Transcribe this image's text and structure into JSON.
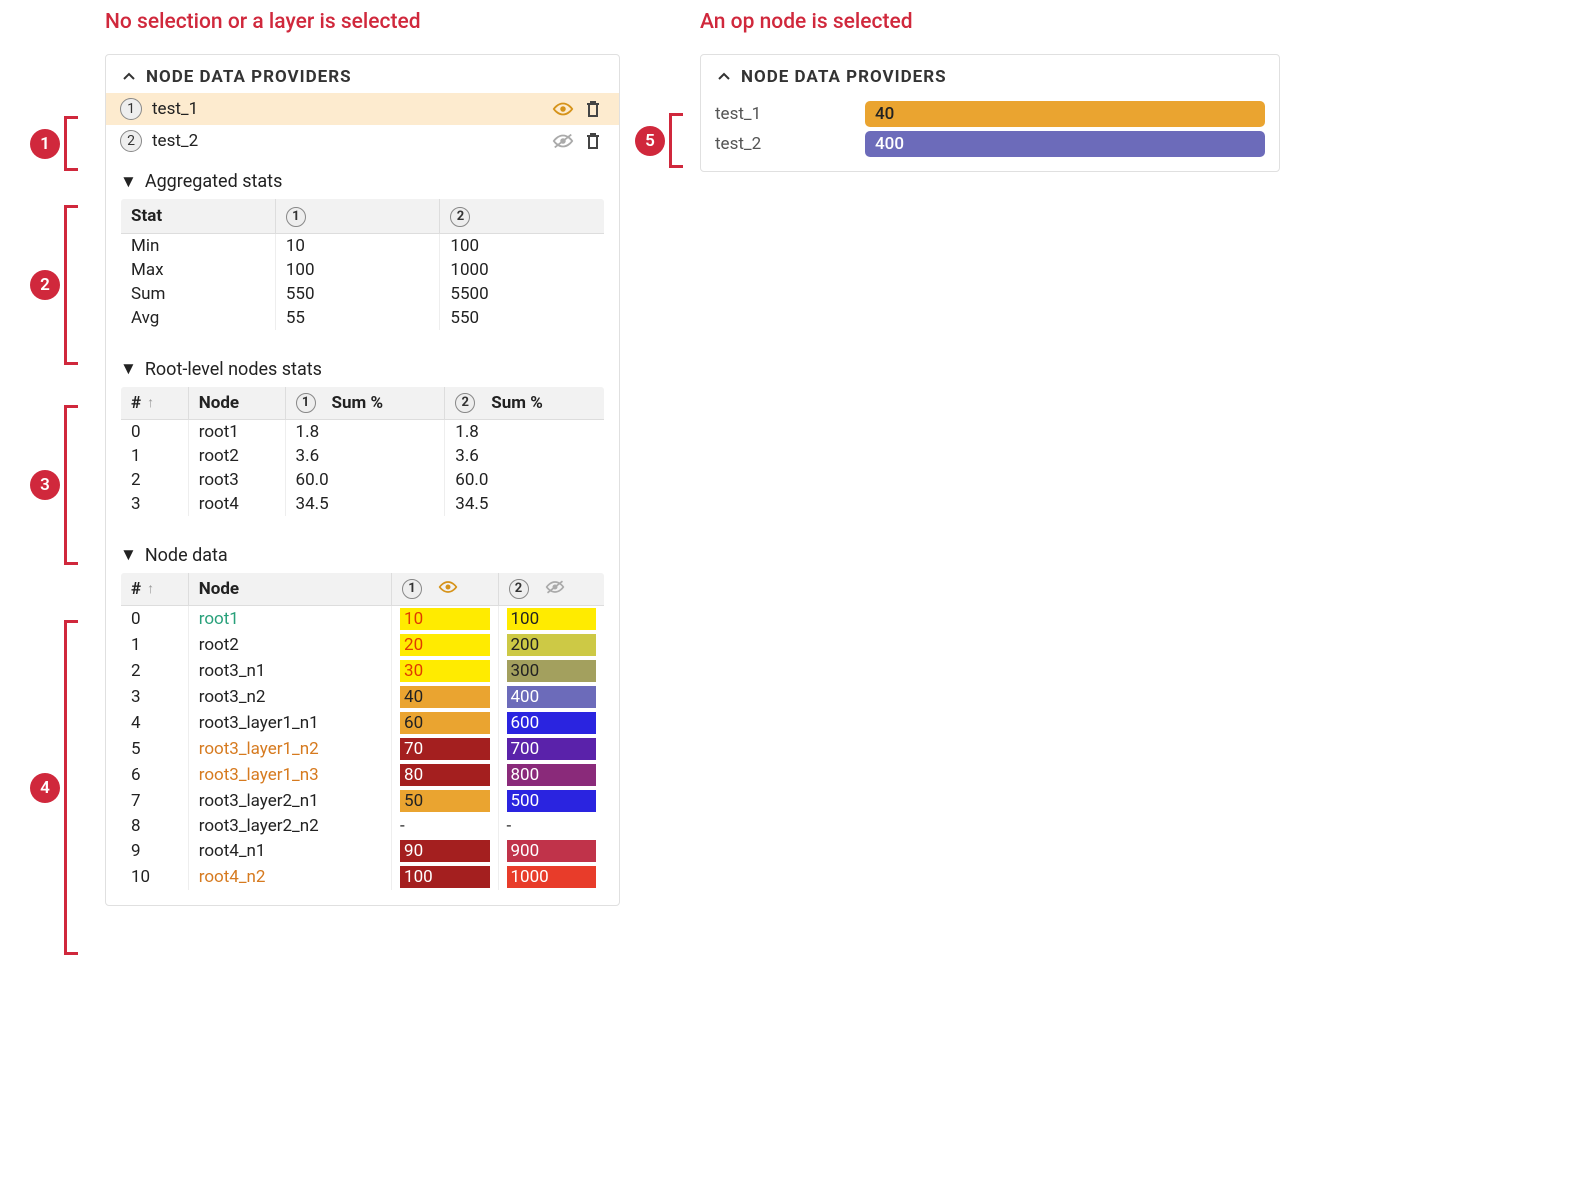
{
  "left": {
    "heading": "No selection or a layer is selected",
    "panel_title": "NODE DATA PROVIDERS",
    "providers": [
      {
        "label": "test_1",
        "badge": "1",
        "active": true,
        "visible": true
      },
      {
        "label": "test_2",
        "badge": "2",
        "active": false,
        "visible": false
      }
    ],
    "aggregated": {
      "title": "Aggregated stats",
      "headers": {
        "stat": "Stat",
        "c1": "1",
        "c2": "2"
      },
      "rows": [
        {
          "stat": "Min",
          "c1": "10",
          "c2": "100"
        },
        {
          "stat": "Max",
          "c1": "100",
          "c2": "1000"
        },
        {
          "stat": "Sum",
          "c1": "550",
          "c2": "5500"
        },
        {
          "stat": "Avg",
          "c1": "55",
          "c2": "550"
        }
      ]
    },
    "root_stats": {
      "title": "Root-level nodes stats",
      "headers": {
        "idx": "#",
        "node": "Node",
        "c1": "Sum %",
        "c2": "Sum %"
      },
      "rows": [
        {
          "idx": "0",
          "node": "root1",
          "c1": "1.8",
          "c2": "1.8"
        },
        {
          "idx": "1",
          "node": "root2",
          "c1": "3.6",
          "c2": "3.6"
        },
        {
          "idx": "2",
          "node": "root3",
          "c1": "60.0",
          "c2": "60.0"
        },
        {
          "idx": "3",
          "node": "root4",
          "c1": "34.5",
          "c2": "34.5"
        }
      ]
    },
    "node_data": {
      "title": "Node data",
      "headers": {
        "idx": "#",
        "node": "Node"
      },
      "rows": [
        {
          "idx": "0",
          "node": "root1",
          "node_style": "link-green",
          "v1": "10",
          "bg1": "#ffeb00",
          "fg1": "#e03c00",
          "v2": "100",
          "bg2": "#ffeb00",
          "fg2": "#222"
        },
        {
          "idx": "1",
          "node": "root2",
          "node_style": "",
          "v1": "20",
          "bg1": "#ffeb00",
          "fg1": "#e03c00",
          "v2": "200",
          "bg2": "#cdc945",
          "fg2": "#222"
        },
        {
          "idx": "2",
          "node": "root3_n1",
          "node_style": "",
          "v1": "30",
          "bg1": "#ffeb00",
          "fg1": "#e03c00",
          "v2": "300",
          "bg2": "#a3a05e",
          "fg2": "#222"
        },
        {
          "idx": "3",
          "node": "root3_n2",
          "node_style": "",
          "v1": "40",
          "bg1": "#eaa430",
          "fg1": "#222",
          "v2": "400",
          "bg2": "#6c6bba",
          "fg2": "#fff"
        },
        {
          "idx": "4",
          "node": "root3_layer1_n1",
          "node_style": "",
          "v1": "60",
          "bg1": "#eaa430",
          "fg1": "#222",
          "v2": "600",
          "bg2": "#2a24e0",
          "fg2": "#fff"
        },
        {
          "idx": "5",
          "node": "root3_layer1_n2",
          "node_style": "link-orange",
          "v1": "70",
          "bg1": "#a41f1f",
          "fg1": "#fff",
          "v2": "700",
          "bg2": "#5a22aa",
          "fg2": "#fff"
        },
        {
          "idx": "6",
          "node": "root3_layer1_n3",
          "node_style": "link-orange",
          "v1": "80",
          "bg1": "#a41f1f",
          "fg1": "#fff",
          "v2": "800",
          "bg2": "#8a2a7a",
          "fg2": "#fff"
        },
        {
          "idx": "7",
          "node": "root3_layer2_n1",
          "node_style": "",
          "v1": "50",
          "bg1": "#eaa430",
          "fg1": "#222",
          "v2": "500",
          "bg2": "#2a24e0",
          "fg2": "#fff"
        },
        {
          "idx": "8",
          "node": "root3_layer2_n2",
          "node_style": "",
          "v1": "-",
          "bg1": "",
          "fg1": "#222",
          "v2": "-",
          "bg2": "",
          "fg2": "#222"
        },
        {
          "idx": "9",
          "node": "root4_n1",
          "node_style": "",
          "v1": "90",
          "bg1": "#a41f1f",
          "fg1": "#fff",
          "v2": "900",
          "bg2": "#c0334a",
          "fg2": "#fff"
        },
        {
          "idx": "10",
          "node": "root4_n2",
          "node_style": "link-orange",
          "v1": "100",
          "bg1": "#a41f1f",
          "fg1": "#fff",
          "v2": "1000",
          "bg2": "#e83c2a",
          "fg2": "#fff"
        }
      ]
    }
  },
  "right": {
    "heading": "An op node is selected",
    "panel_title": "NODE DATA PROVIDERS",
    "rows": [
      {
        "label": "test_1",
        "value": "40",
        "bg": "#eaa430",
        "fg": "#222"
      },
      {
        "label": "test_2",
        "value": "400",
        "bg": "#6c6bba",
        "fg": "#fff"
      }
    ]
  },
  "callouts": {
    "c1": "1",
    "c2": "2",
    "c3": "3",
    "c4": "4",
    "c5": "5"
  }
}
